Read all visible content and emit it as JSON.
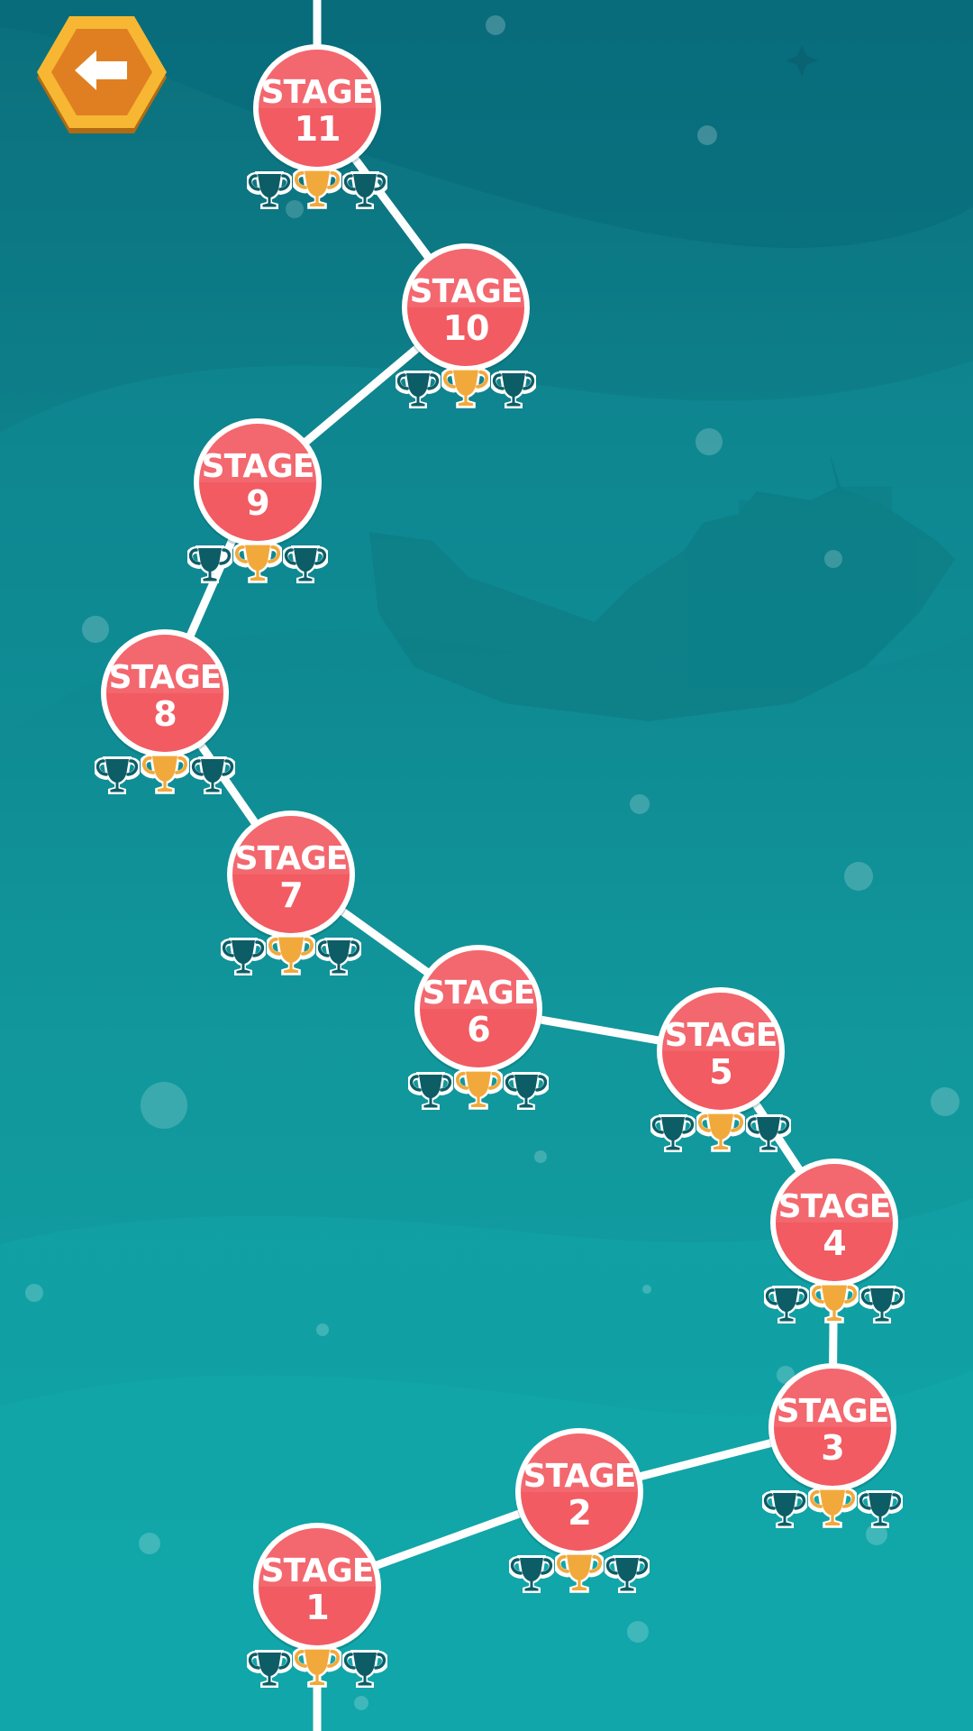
{
  "back_button": {
    "icon": "arrow-left-icon"
  },
  "colors": {
    "sea_dark": "#0b6f7c",
    "sea_light": "#10a3a6",
    "node_red": "#f25b62",
    "node_border": "#ffffff",
    "trophy_gold": "#f2a93b",
    "trophy_dark": "#0d5d66",
    "path": "#ffffff",
    "back_hex_outer": "#f7b733",
    "back_hex_inner": "#e07f22"
  },
  "stages": [
    {
      "line1": "STAGE",
      "line2": "1",
      "trophies": [
        "dark",
        "gold",
        "dark"
      ]
    },
    {
      "line1": "STAGE",
      "line2": "2",
      "trophies": [
        "dark",
        "gold",
        "dark"
      ]
    },
    {
      "line1": "STAGE",
      "line2": "3",
      "trophies": [
        "dark",
        "gold",
        "dark"
      ]
    },
    {
      "line1": "STAGE",
      "line2": "4",
      "trophies": [
        "dark",
        "gold",
        "dark"
      ]
    },
    {
      "line1": "STAGE",
      "line2": "5",
      "trophies": [
        "dark",
        "gold",
        "dark"
      ]
    },
    {
      "line1": "STAGE",
      "line2": "6",
      "trophies": [
        "dark",
        "gold",
        "dark"
      ]
    },
    {
      "line1": "STAGE",
      "line2": "7",
      "trophies": [
        "dark",
        "gold",
        "dark"
      ]
    },
    {
      "line1": "STAGE",
      "line2": "8",
      "trophies": [
        "dark",
        "gold",
        "dark"
      ]
    },
    {
      "line1": "STAGE",
      "line2": "9",
      "trophies": [
        "dark",
        "gold",
        "dark"
      ]
    },
    {
      "line1": "STAGE",
      "line2": "10",
      "trophies": [
        "dark",
        "gold",
        "dark"
      ]
    },
    {
      "line1": "STAGE",
      "line2": "11",
      "trophies": [
        "dark",
        "gold",
        "dark"
      ]
    }
  ]
}
